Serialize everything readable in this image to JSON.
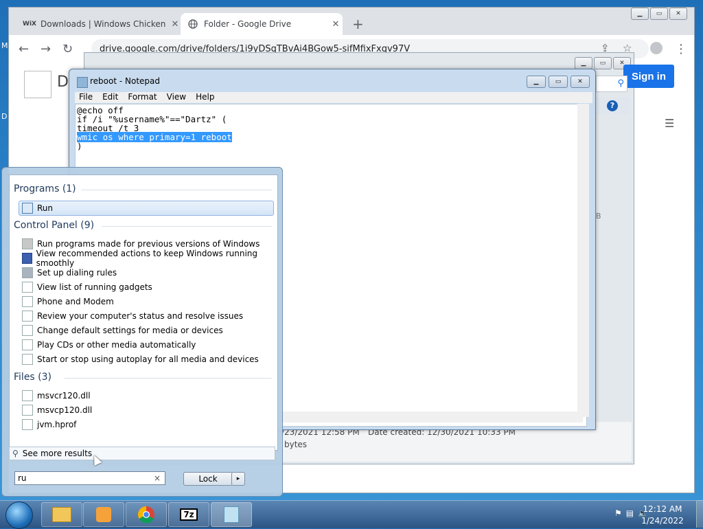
{
  "desktop": {
    "edge_left_top": "M",
    "edge_left_mid": "D"
  },
  "chrome": {
    "tabs": [
      {
        "favicon": "WiX",
        "title": "Downloads | Windows Chicken",
        "close": "✕"
      },
      {
        "favicon": "globe-icon",
        "title": "Folder - Google Drive",
        "close": "✕"
      }
    ],
    "new_tab": "+",
    "url": "drive.google.com/drive/folders/1i9yDSqTBvAi4BGow5-sifMfixFxqv97V",
    "page_header": "Dr",
    "sign_in": "Sign in",
    "help": "?",
    "partial_char": "B"
  },
  "drive_info": {
    "modified": "/23/2021 12:58 PM",
    "created_label": "Date created:",
    "created_value": "12/30/2021 10:33 PM",
    "size": "bytes"
  },
  "notepad": {
    "title": "reboot - Notepad",
    "menu": [
      "File",
      "Edit",
      "Format",
      "View",
      "Help"
    ],
    "lines": [
      "@echo off",
      "if /i \"%username%\"==\"Dartz\" (",
      "timeout /t 3",
      "wmic os where primary=1 reboot",
      ")"
    ]
  },
  "start_menu": {
    "programs_header": "Programs (1)",
    "programs": [
      "Run"
    ],
    "control_header": "Control Panel (9)",
    "control_items": [
      "Run programs made for previous versions of Windows",
      "View recommended actions to keep Windows running smoothly",
      "Set up dialing rules",
      "View list of running gadgets",
      "Phone and Modem",
      "Review your computer's status and resolve issues",
      "Change default settings for media or devices",
      "Play CDs or other media automatically",
      "Start or stop using autoplay for all media and devices"
    ],
    "files_header": "Files (3)",
    "files": [
      "msvcr120.dll",
      "msvcp120.dll",
      "jvm.hprof"
    ],
    "see_more": "See more results",
    "search_value": "ru",
    "clear": "×",
    "lock_label": "Lock",
    "lock_arrow": "▸"
  },
  "taskbar": {
    "time": "12:12 AM",
    "date": "1/24/2022",
    "app_7z": "7z"
  }
}
